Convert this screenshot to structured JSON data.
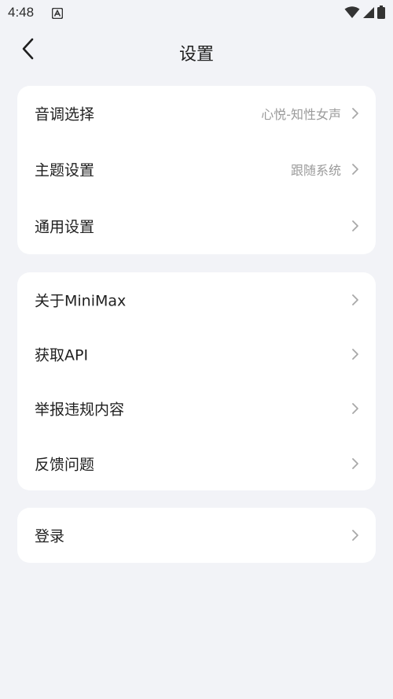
{
  "status_bar": {
    "time": "4:48"
  },
  "header": {
    "title": "设置"
  },
  "group1": {
    "items": [
      {
        "label": "音调选择",
        "value": "心悦-知性女声"
      },
      {
        "label": "主题设置",
        "value": "跟随系统"
      },
      {
        "label": "通用设置",
        "value": ""
      }
    ]
  },
  "group2": {
    "items": [
      {
        "label": "关于MiniMax"
      },
      {
        "label": "获取API"
      },
      {
        "label": "举报违规内容"
      },
      {
        "label": "反馈问题"
      }
    ]
  },
  "group3": {
    "items": [
      {
        "label": "登录"
      }
    ]
  },
  "icons": {
    "back": "chevron-left-icon",
    "row_arrow": "chevron-right-icon",
    "wifi": "wifi-icon",
    "signal": "signal-icon",
    "battery": "battery-icon",
    "notification": "notification-icon"
  }
}
